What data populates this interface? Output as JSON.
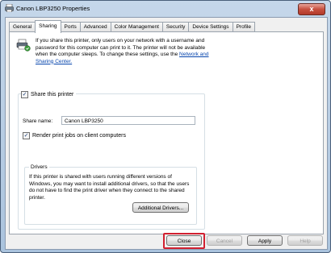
{
  "window": {
    "title": "Canon LBP3250 Properties",
    "close_glyph": "x"
  },
  "tabs": [
    {
      "label": "General"
    },
    {
      "label": "Sharing"
    },
    {
      "label": "Ports"
    },
    {
      "label": "Advanced"
    },
    {
      "label": "Color Management"
    },
    {
      "label": "Security"
    },
    {
      "label": "Device Settings"
    },
    {
      "label": "Profile"
    }
  ],
  "sharing": {
    "info_text": "If you share this printer, only users on your network with a username and password for this computer can print to it. The printer will not be available when the computer sleeps. To change these settings, use the",
    "info_link": "Network and Sharing Center.",
    "share_checkbox_label": "Share this printer",
    "share_checked": true,
    "share_name_label": "Share name:",
    "share_name_value": "Canon LBP3250",
    "render_checkbox_label": "Render print jobs on client computers",
    "render_checked": true,
    "drivers_legend": "Drivers",
    "drivers_text": "If this printer is shared with users running different versions of Windows, you may want to install additional drivers, so that the users do not have to find the print driver when they connect to the shared printer.",
    "additional_drivers_button": "Additional Drivers..."
  },
  "footer": {
    "close_label": "Close",
    "cancel_label": "Cancel",
    "apply_label": "Apply",
    "help_label": "Help"
  },
  "colors": {
    "highlight": "#d22030",
    "link": "#0645ad"
  }
}
